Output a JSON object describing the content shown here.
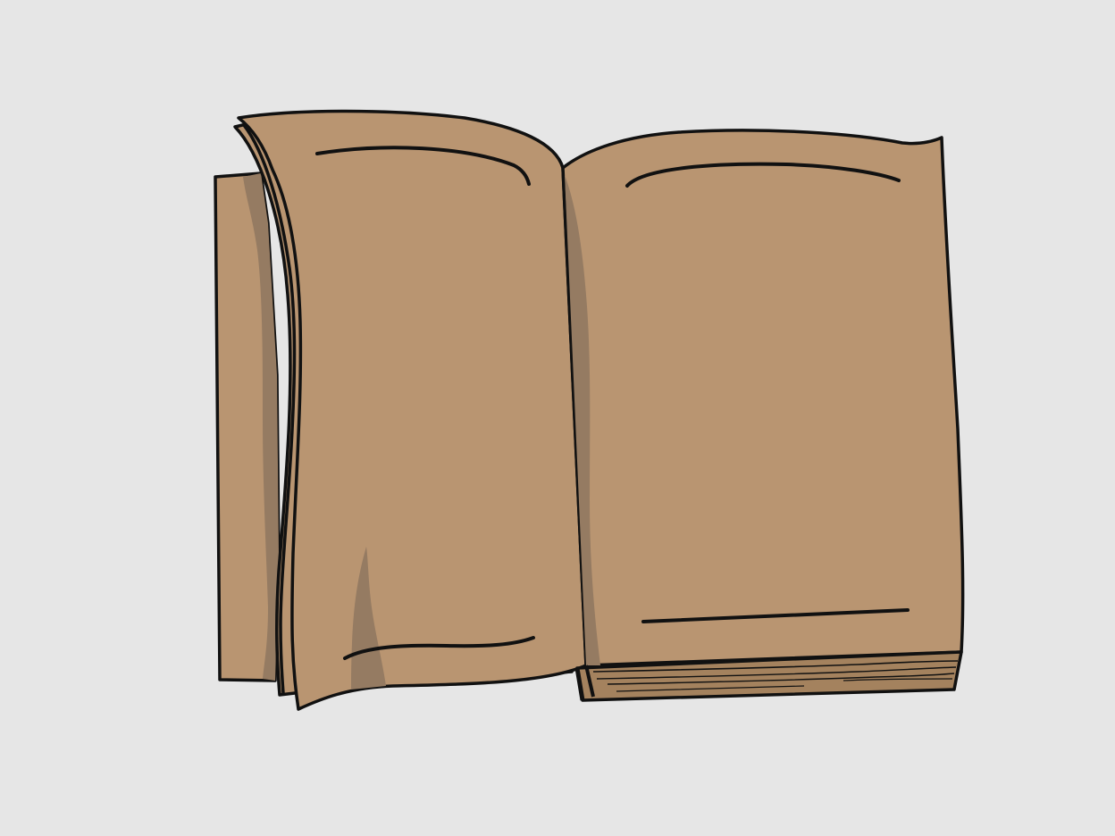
{
  "colors": {
    "background": "#e6e6e6",
    "page": "#b99571",
    "page_shadow": "#957b62",
    "page_edge_shade": "#a4825e",
    "outline": "#111111"
  },
  "illustration": {
    "subject": "open-book-icon"
  }
}
